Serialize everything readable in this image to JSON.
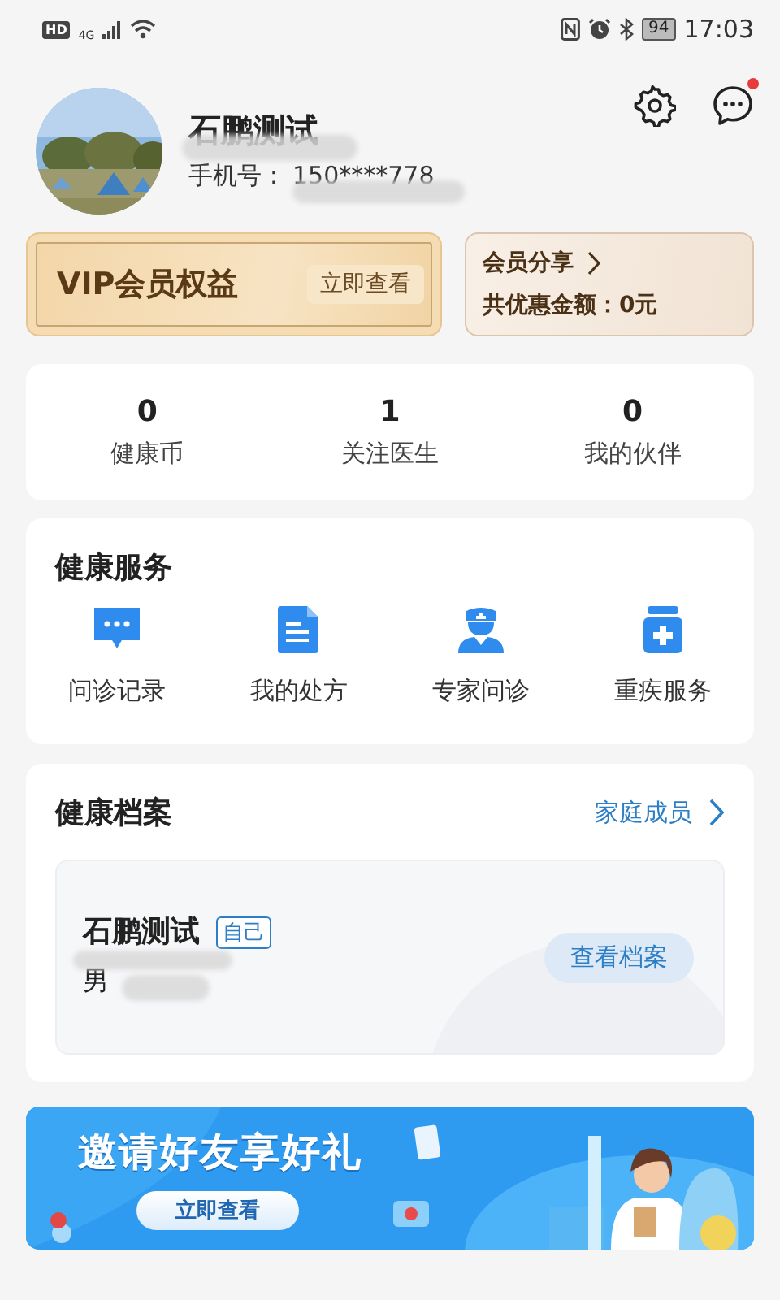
{
  "status_bar": {
    "hd": "HD",
    "network": "4G",
    "battery": "94",
    "time": "17:03"
  },
  "profile": {
    "name": "石鹏测试",
    "phone_label": "手机号：",
    "phone": "150****778",
    "unread": true
  },
  "vip": {
    "title": "VIP会员权益",
    "button": "立即查看"
  },
  "share": {
    "title": "会员分享",
    "savings": "共优惠金额：0元"
  },
  "stats": [
    {
      "value": "0",
      "label": "健康币"
    },
    {
      "value": "1",
      "label": "关注医生"
    },
    {
      "value": "0",
      "label": "我的伙伴"
    }
  ],
  "services": {
    "title": "健康服务",
    "items": [
      {
        "label": "问诊记录",
        "kind": "chat"
      },
      {
        "label": "我的处方",
        "kind": "document"
      },
      {
        "label": "专家问诊",
        "kind": "doctor"
      },
      {
        "label": "重疾服务",
        "kind": "medicine"
      }
    ]
  },
  "archive": {
    "title": "健康档案",
    "link": "家庭成员",
    "record": {
      "name": "石鹏测试",
      "tag": "自己",
      "gender": "男",
      "button": "查看档案"
    }
  },
  "banner": {
    "title": "邀请好友享好礼",
    "button": "立即查看"
  }
}
